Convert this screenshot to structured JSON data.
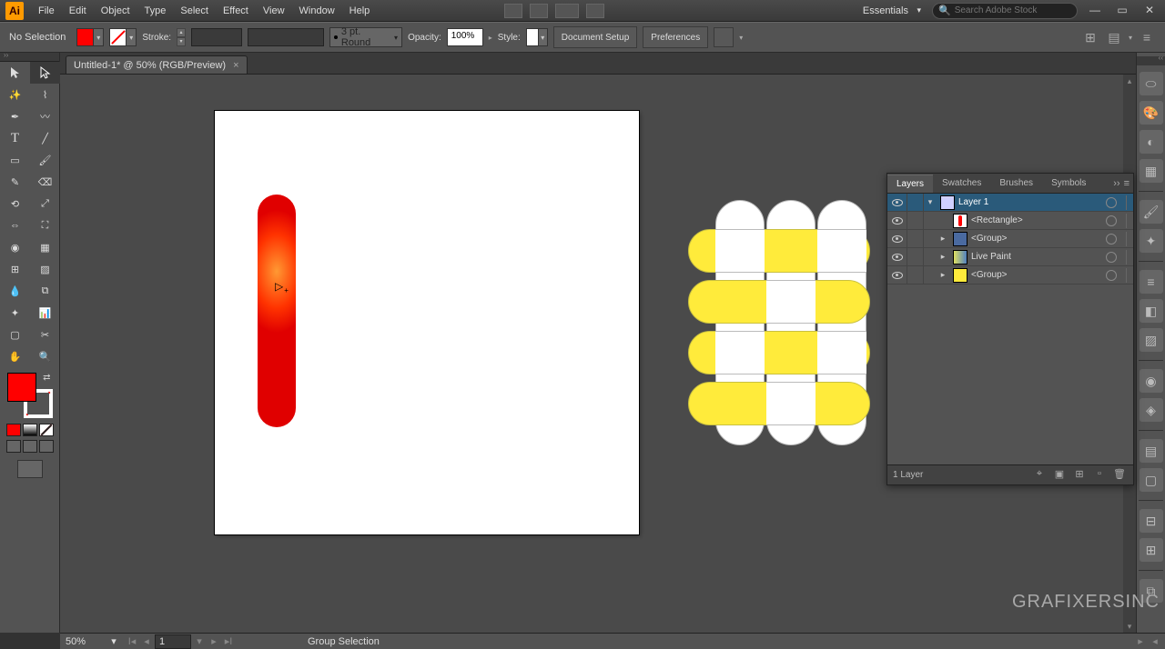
{
  "app": {
    "logo_text": "Ai"
  },
  "menu": [
    "File",
    "Edit",
    "Object",
    "Type",
    "Select",
    "Effect",
    "View",
    "Window",
    "Help"
  ],
  "workspace": "Essentials",
  "search": {
    "placeholder": "Search Adobe Stock"
  },
  "control": {
    "selection_label": "No Selection",
    "stroke_label": "Stroke:",
    "brush_label": "3 pt. Round",
    "opacity_label": "Opacity:",
    "opacity_value": "100%",
    "style_label": "Style:",
    "doc_setup": "Document Setup",
    "prefs": "Preferences"
  },
  "document": {
    "tab_title": "Untitled-1* @ 50% (RGB/Preview)"
  },
  "layers_panel": {
    "tabs": [
      "Layers",
      "Swatches",
      "Brushes",
      "Symbols"
    ],
    "rows": [
      {
        "name": "Layer 1",
        "top": true,
        "indent": 0,
        "expanded_open": true
      },
      {
        "name": "<Rectangle>",
        "top": false,
        "indent": 1,
        "thumb": "rect-red"
      },
      {
        "name": "<Group>",
        "top": false,
        "indent": 1,
        "thumb": "group-blue",
        "expandable": true
      },
      {
        "name": "Live Paint",
        "top": false,
        "indent": 1,
        "thumb": "livepaint",
        "expandable": true
      },
      {
        "name": "<Group>",
        "top": false,
        "indent": 1,
        "thumb": "group-yellow",
        "expandable": true
      }
    ],
    "footer_count": "1 Layer"
  },
  "status": {
    "zoom": "50%",
    "artboard": "1",
    "tool": "Group Selection"
  },
  "watermark": "GRAFIXERSINC"
}
